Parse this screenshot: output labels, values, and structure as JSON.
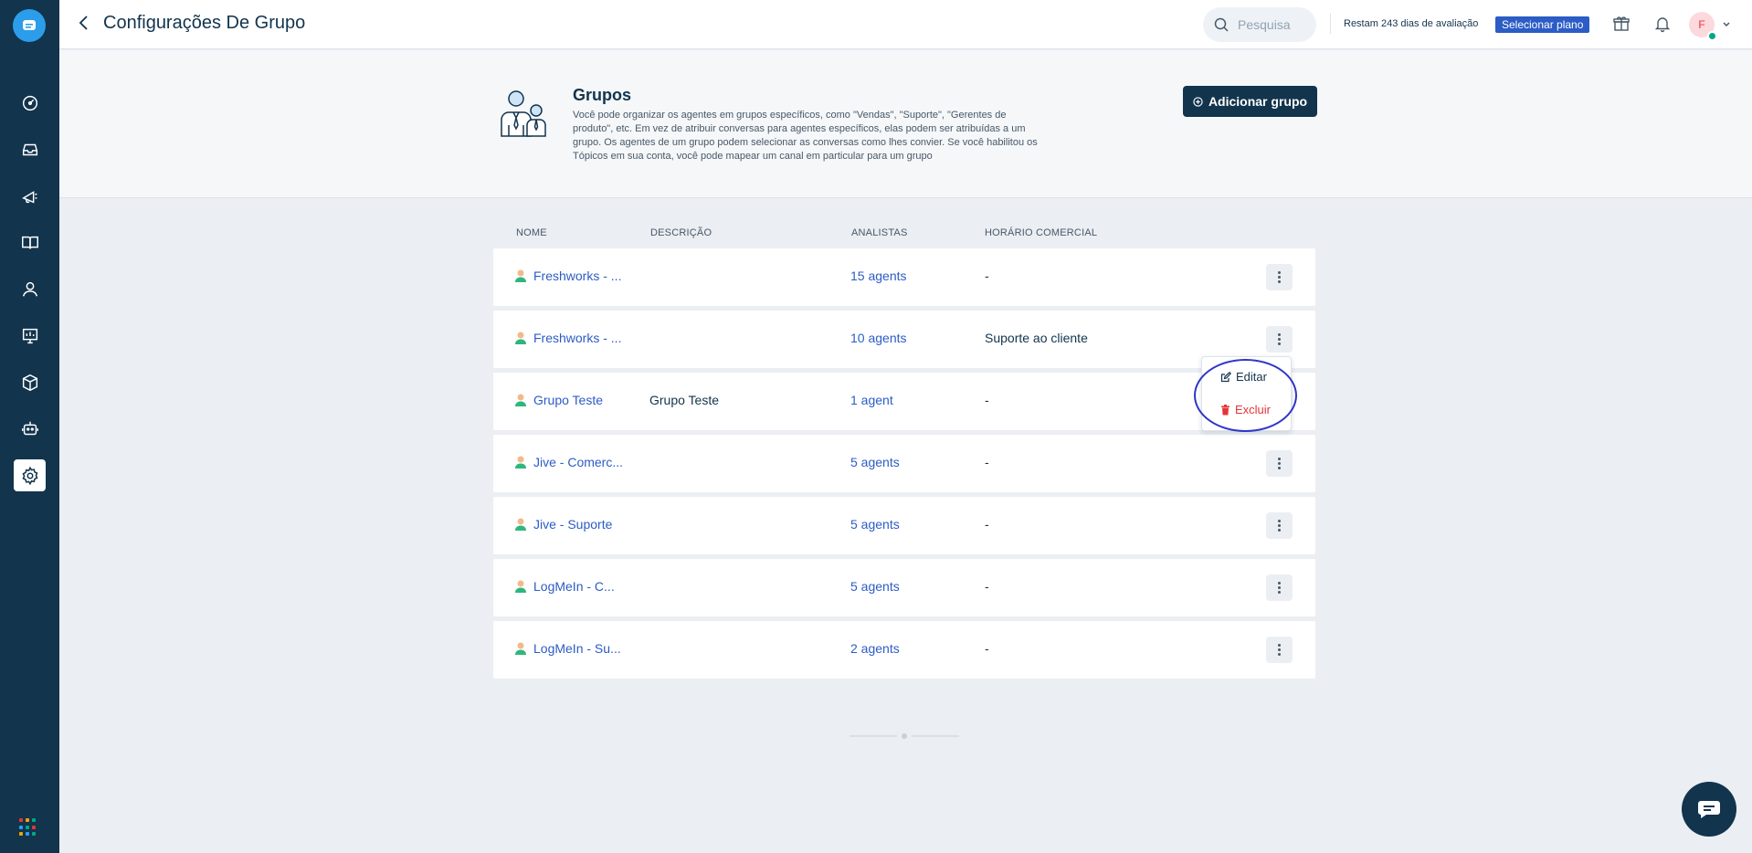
{
  "header": {
    "title": "Configurações De Grupo",
    "search_placeholder": "Pesquisa",
    "trial_text": "Restam 243 dias de avaliação",
    "plan_button": "Selecionar plano",
    "avatar_initial": "F"
  },
  "sidebar": {
    "items": [
      {
        "icon": "dashboard-icon"
      },
      {
        "icon": "inbox-icon"
      },
      {
        "icon": "campaigns-icon"
      },
      {
        "icon": "knowledge-base-icon"
      },
      {
        "icon": "contacts-icon"
      },
      {
        "icon": "reports-icon"
      },
      {
        "icon": "integrations-icon"
      },
      {
        "icon": "bot-icon"
      },
      {
        "icon": "settings-icon",
        "active": true
      }
    ]
  },
  "intro": {
    "title": "Grupos",
    "description": "Você pode organizar os agentes em grupos específicos, como \"Vendas\", \"Suporte\", \"Gerentes de produto\", etc. Em vez de atribuir conversas para agentes específicos, elas podem ser atribuídas a um grupo. Os agentes de um grupo podem selecionar as conversas como lhes convier. Se você habilitou os Tópicos em sua conta, você pode mapear um canal em particular para um grupo",
    "add_button": "Adicionar grupo"
  },
  "table": {
    "columns": [
      "NOME",
      "DESCRIÇÃO",
      "ANALISTAS",
      "HORÁRIO COMERCIAL"
    ],
    "rows": [
      {
        "name": "Freshworks - ...",
        "description": "",
        "agents": "15 agents",
        "hours": "-"
      },
      {
        "name": "Freshworks - ...",
        "description": "",
        "agents": "10 agents",
        "hours": "Suporte ao cliente"
      },
      {
        "name": "Grupo Teste",
        "description": "Grupo Teste",
        "agents": "1 agent",
        "hours": "-"
      },
      {
        "name": "Jive - Comerc...",
        "description": "",
        "agents": "5 agents",
        "hours": "-"
      },
      {
        "name": "Jive - Suporte",
        "description": "",
        "agents": "5 agents",
        "hours": "-"
      },
      {
        "name": "LogMeIn - C...",
        "description": "",
        "agents": "5 agents",
        "hours": "-"
      },
      {
        "name": "LogMeIn - Su...",
        "description": "",
        "agents": "2 agents",
        "hours": "-"
      }
    ]
  },
  "row_menu": {
    "edit": "Editar",
    "delete": "Excluir"
  },
  "colors": {
    "sidebar": "#12344d",
    "link": "#2c5cc5",
    "danger": "#e43538",
    "highlight": "#2f35c8"
  }
}
